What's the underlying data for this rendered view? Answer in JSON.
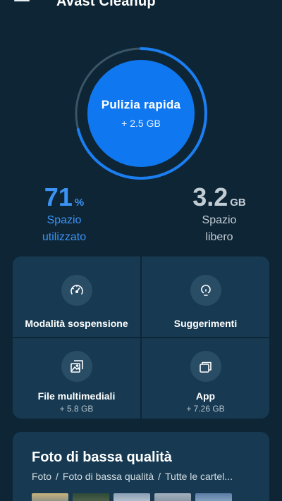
{
  "header": {
    "title": "Avast Cleanup",
    "menu_icon": "hamburger-menu-icon"
  },
  "quick_clean": {
    "label": "Pulizia rapida",
    "amount": "+ 2.5 GB",
    "usage_percent": 71
  },
  "stats": {
    "used": {
      "value": "71",
      "unit": "%",
      "label_line1": "Spazio",
      "label_line2": "utilizzato"
    },
    "free": {
      "value": "3.2",
      "unit": "GB",
      "label_line1": "Spazio",
      "label_line2": "libero"
    }
  },
  "tiles": [
    {
      "icon": "speedometer-icon",
      "label": "Modalità sospensione"
    },
    {
      "icon": "lightbulb-icon",
      "label": "Suggerimenti"
    },
    {
      "icon": "image-stack-icon",
      "label": "File multimediali",
      "sub": "+ 5.8 GB"
    },
    {
      "icon": "app-stack-icon",
      "label": "App",
      "sub": "+ 7.26 GB"
    }
  ],
  "low_quality_card": {
    "title": "Foto di bassa qualità",
    "breadcrumb": [
      "Foto",
      "Foto di bassa qualità",
      "Tutte le cartel..."
    ]
  },
  "colors": {
    "background": "#0e2536",
    "tile": "#173a52",
    "accent": "#0f78f0",
    "accent_text": "#3b94f5",
    "ring_track": "#3a5566"
  }
}
